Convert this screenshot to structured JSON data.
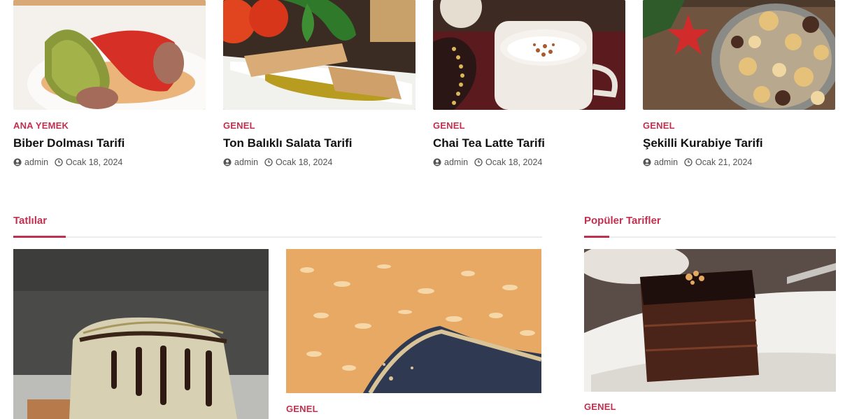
{
  "posts": [
    {
      "category": "ANA YEMEK",
      "title": "Biber Dolması Tarifi",
      "author": "admin",
      "date": "Ocak 18, 2024"
    },
    {
      "category": "GENEL",
      "title": "Ton Balıklı Salata Tarifi",
      "author": "admin",
      "date": "Ocak 18, 2024"
    },
    {
      "category": "GENEL",
      "title": "Chai Tea Latte Tarifi",
      "author": "admin",
      "date": "Ocak 18, 2024"
    },
    {
      "category": "GENEL",
      "title": "Şekilli Kurabiye Tarifi",
      "author": "admin",
      "date": "Ocak 21, 2024"
    }
  ],
  "sections": {
    "desserts": {
      "heading": "Tatlılar",
      "second_post_category": "GENEL"
    },
    "popular": {
      "heading": "Popüler Tarifler",
      "first_post_category": "GENEL"
    }
  },
  "colors": {
    "accent": "#c0304f",
    "text": "#111111",
    "meta": "#555555",
    "divider": "#ececec"
  },
  "icons": {
    "author": "user-circle-icon",
    "date": "clock-icon"
  }
}
